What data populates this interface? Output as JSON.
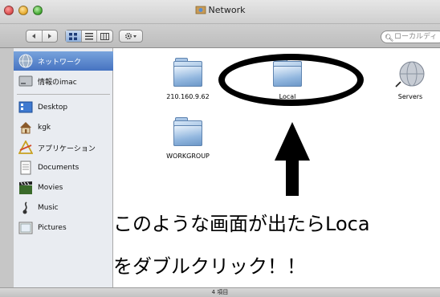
{
  "window": {
    "title": "Network"
  },
  "toolbar": {
    "search_placeholder": "ローカルディ"
  },
  "sidebar": {
    "items": [
      {
        "label": "ネットワーク",
        "icon": "network-globe-icon"
      },
      {
        "label": "情報のimac",
        "icon": "hard-drive-icon"
      },
      {
        "label": "Desktop",
        "icon": "desktop-icon"
      },
      {
        "label": "kgk",
        "icon": "home-icon"
      },
      {
        "label": "アプリケーション",
        "icon": "applications-icon"
      },
      {
        "label": "Documents",
        "icon": "documents-icon"
      },
      {
        "label": "Movies",
        "icon": "movies-icon"
      },
      {
        "label": "Music",
        "icon": "music-icon"
      },
      {
        "label": "Pictures",
        "icon": "pictures-icon"
      }
    ]
  },
  "main": {
    "items": [
      {
        "label": "210.160.9.62",
        "icon": "folder-icon"
      },
      {
        "label": "Local",
        "icon": "folder-icon"
      },
      {
        "label": "Servers",
        "icon": "server-icon"
      },
      {
        "label": "WORKGROUP",
        "icon": "folder-icon"
      }
    ]
  },
  "annotation": {
    "line1": "このような画面が出たらLoca",
    "line2": "をダブルクリック！！"
  },
  "status": {
    "text": "4 項目"
  },
  "colors": {
    "selection": "#5b86cf",
    "folder": "#7fa7d3"
  }
}
